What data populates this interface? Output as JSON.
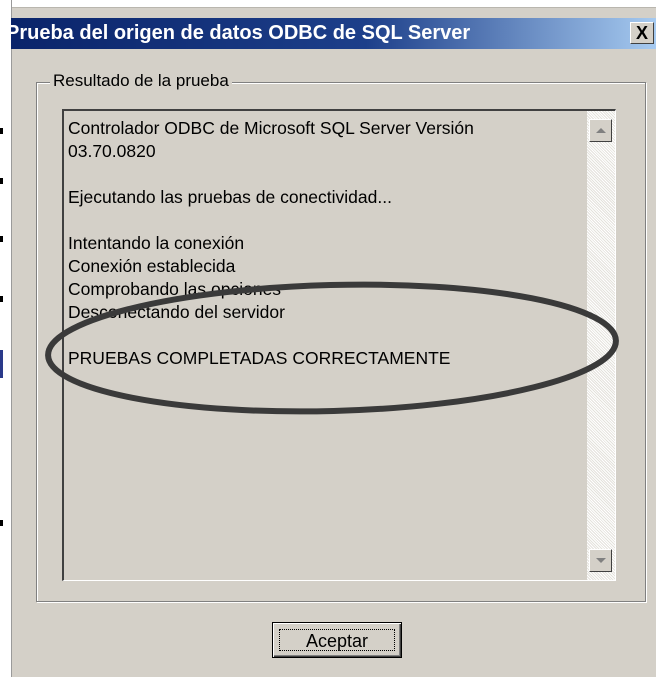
{
  "window": {
    "title": "Prueba del origen de datos ODBC de SQL Server",
    "close_symbol": "X"
  },
  "group": {
    "label": "Resultado de la prueba"
  },
  "result": {
    "lines": [
      "Controlador ODBC de Microsoft SQL Server Versión",
      "03.70.0820",
      "",
      "Ejecutando las pruebas de conectividad...",
      "",
      "Intentando la conexión",
      "Conexión establecida",
      "Comprobando las opciones",
      "Desconectando del servidor",
      "",
      "PRUEBAS COMPLETADAS CORRECTAMENTE"
    ]
  },
  "buttons": {
    "ok_label": "Aceptar"
  },
  "icons": {
    "close": "close-icon",
    "scroll_up": "scroll-up-arrow-icon",
    "scroll_down": "scroll-down-arrow-icon"
  },
  "colors": {
    "titlebar_start": "#0a246a",
    "titlebar_end": "#a6caf0",
    "dialog_bg": "#d4d0c8",
    "annotation_ellipse": "#3a3a3a"
  }
}
